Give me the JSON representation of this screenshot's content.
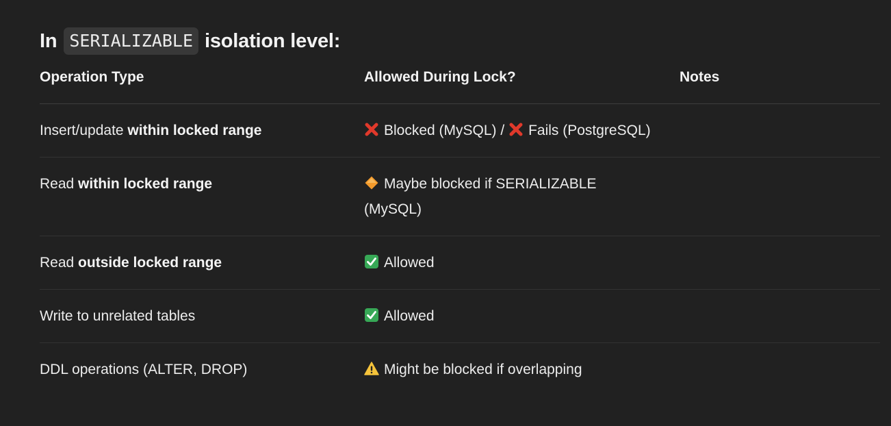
{
  "heading": {
    "prefix": "In",
    "code": "SERIALIZABLE",
    "suffix": "isolation level:"
  },
  "table": {
    "headers": [
      "Operation Type",
      "Allowed During Lock?",
      "Notes"
    ],
    "rows": [
      {
        "op_plain": "Insert/update ",
        "op_bold": "within locked range",
        "allowed": [
          {
            "icon": "cross-mark-icon",
            "text": "Blocked (MySQL) / "
          },
          {
            "icon": "cross-mark-icon",
            "text": "Fails (PostgreSQL)"
          }
        ],
        "notes": ""
      },
      {
        "op_plain": "Read ",
        "op_bold": "within locked range",
        "allowed": [
          {
            "icon": "orange-diamond-icon",
            "text": "Maybe blocked if SERIALIZABLE (MySQL)"
          }
        ],
        "notes": ""
      },
      {
        "op_plain": "Read ",
        "op_bold": "outside locked range",
        "allowed": [
          {
            "icon": "check-mark-icon",
            "text": "Allowed"
          }
        ],
        "notes": ""
      },
      {
        "op_plain": "Write to unrelated tables",
        "op_bold": "",
        "allowed": [
          {
            "icon": "check-mark-icon",
            "text": "Allowed"
          }
        ],
        "notes": ""
      },
      {
        "op_plain": "DDL operations (ALTER, DROP)",
        "op_bold": "",
        "allowed": [
          {
            "icon": "warning-icon",
            "text": "Might be blocked if overlapping"
          }
        ],
        "notes": ""
      }
    ]
  },
  "colors": {
    "background": "#212121",
    "cross": "#e0392b",
    "check": "#37a856",
    "diamond": "#f39a2b",
    "warning": "#f5c33b"
  }
}
